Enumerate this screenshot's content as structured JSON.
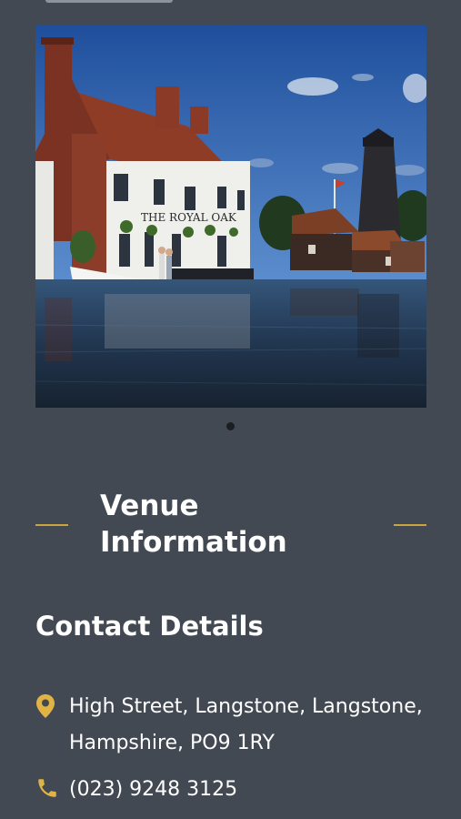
{
  "gallery": {
    "image_alt": "THE ROYAL OAK",
    "sign_text": "THE ROYAL OAK",
    "pagination_count": 1,
    "active_index": 1
  },
  "venue": {
    "heading": "Venue Information"
  },
  "contact": {
    "heading": "Contact Details",
    "address_icon": "map-pin-icon",
    "address": "High Street, Langstone, Langstone, Hampshire, PO9 1RY",
    "phone_icon": "phone-icon",
    "phone": "(023) 9248 3125"
  },
  "colors": {
    "background": "#424953",
    "accent": "#c9a43f",
    "text": "#ffffff"
  }
}
